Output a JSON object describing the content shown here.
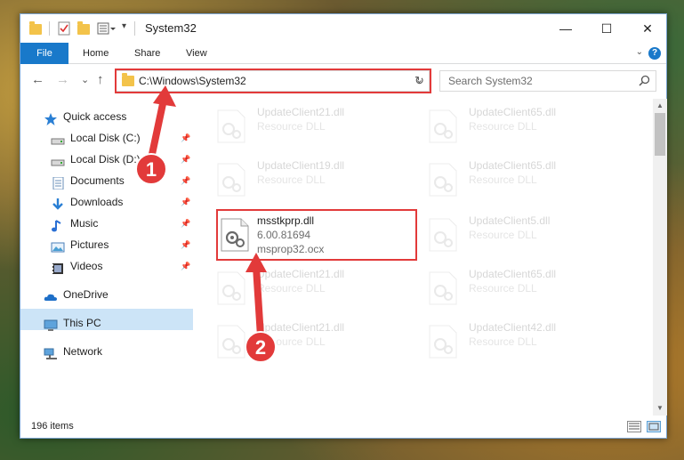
{
  "window": {
    "title": "System32",
    "minimize": "—",
    "maximize": "☐",
    "close": "✕"
  },
  "ribbon": {
    "tabs": [
      "File",
      "Home",
      "Share",
      "View"
    ],
    "help": "?"
  },
  "nav": {
    "back": "←",
    "forward": "→",
    "recent": "⌄",
    "up": "↑",
    "address": "C:\\Windows\\System32",
    "refresh": "↻",
    "search_placeholder": "Search System32"
  },
  "sidebar": {
    "items": [
      {
        "label": "Quick access",
        "icon": "star-icon"
      },
      {
        "label": "Local Disk (C:)",
        "icon": "drive-icon"
      },
      {
        "label": "Local Disk (D:)",
        "icon": "drive-icon"
      },
      {
        "label": "Documents",
        "icon": "documents-icon"
      },
      {
        "label": "Downloads",
        "icon": "downloads-icon"
      },
      {
        "label": "Music",
        "icon": "music-icon"
      },
      {
        "label": "Pictures",
        "icon": "pictures-icon"
      },
      {
        "label": "Videos",
        "icon": "videos-icon"
      },
      {
        "label": "OneDrive",
        "icon": "cloud-icon"
      },
      {
        "label": "This PC",
        "icon": "computer-icon"
      },
      {
        "label": "Network",
        "icon": "network-icon"
      }
    ]
  },
  "files": [
    {
      "name": "UpdateClient21.dll",
      "type": "Resource DLL"
    },
    {
      "name": "UpdateClient65.dll",
      "type": "Resource DLL"
    },
    {
      "name": "UpdateClient19.dll",
      "type": "Resource DLL"
    },
    {
      "name": "UpdateClient65.dll",
      "type": "Resource DLL"
    },
    {
      "name": "msstkprp.dll",
      "version": "6.00.81694",
      "desc": "msprop32.ocx"
    },
    {
      "name": "UpdateClient5.dll",
      "type": "Resource DLL"
    },
    {
      "name": "UpdateClient21.dll",
      "type": "Resource DLL"
    },
    {
      "name": "UpdateClient65.dll",
      "type": "Resource DLL"
    },
    {
      "name": "UpdateClient21.dll",
      "type": "Resource DLL"
    },
    {
      "name": "UpdateClient42.dll",
      "type": "Resource DLL"
    }
  ],
  "status": {
    "count": "196 items"
  },
  "annotations": {
    "step1": "1",
    "step2": "2",
    "color": "#e23a3a"
  }
}
